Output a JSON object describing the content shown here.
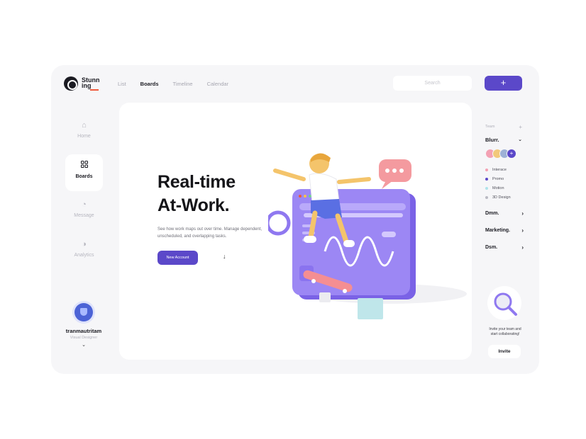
{
  "app": {
    "logo": {
      "line1": "Stunn",
      "line2": "ing"
    },
    "nav": [
      "List",
      "Boards",
      "Timeline",
      "Calendar"
    ],
    "active_nav": "Boards",
    "search": {
      "placeholder": "Search"
    },
    "add_button": "+"
  },
  "sidebar": {
    "items": [
      {
        "label": "Home",
        "icon": "home-icon",
        "active": false
      },
      {
        "label": "Boards",
        "icon": "grid-icon",
        "active": true
      },
      {
        "label": "Message",
        "icon": "message-icon",
        "active": false
      },
      {
        "label": "Analytics",
        "icon": "analytics-icon",
        "active": false
      }
    ],
    "profile": {
      "name": "tranmautritam",
      "role": "Visual Designer",
      "chevron": "⌄"
    }
  },
  "hero": {
    "title_line1": "Real-time",
    "title_line2": "At-Work.",
    "description": "See how work maps out over time. Manage dependent, unscheduled, and overlapping tasks.",
    "cta": "New Account",
    "arrow": "↓"
  },
  "right_panel": {
    "team_header": "Team",
    "team_add": "+",
    "team_name": "Blurr.",
    "member_more": "+",
    "tags": [
      {
        "label": "Interace",
        "color": "#f3a1b3"
      },
      {
        "label": "Promo",
        "color": "#5b48c9"
      },
      {
        "label": "Motion",
        "color": "#aee3ea"
      },
      {
        "label": "3D Design",
        "color": "#b9b9c2"
      }
    ],
    "groups": [
      "Dmm.",
      "Marketing.",
      "Dsm."
    ],
    "invite_text": "Invite your team and start collaborating!",
    "invite_button": "Invite"
  },
  "colors": {
    "accent": "#5b48c9",
    "logo_underline": "#ef5a3c",
    "background": "#f6f6f8"
  }
}
